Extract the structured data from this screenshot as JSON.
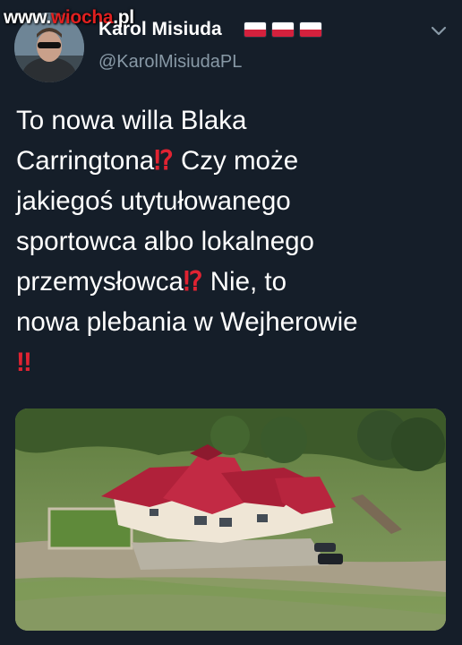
{
  "watermark": {
    "prefix": "www.",
    "accent": "wiocha",
    "suffix": ".pl"
  },
  "author": {
    "display_name": "Karol Misiuda",
    "handle": "@KarolMisiudaPL",
    "flag_count": 3,
    "flag_colors": [
      "#ffffff",
      "#d4213d"
    ]
  },
  "tweet": {
    "line1": "To nowa willa Blaka",
    "line2a": "Carringtona",
    "emoji1": "⁉",
    "line2b": " Czy może",
    "line3": "jakiegoś utytułowanego",
    "line4": "sportowca albo lokalnego",
    "line5a": "przemysłowca",
    "emoji2": "⁉",
    "line5b": " Nie, to",
    "line6": "nowa plebania w Wejherowie",
    "emoji3": "‼"
  },
  "icons": {
    "menu": "chevron-down-icon"
  },
  "colors": {
    "background": "#151e29",
    "secondary_text": "#8899a6",
    "emoji_red": "#e02332"
  }
}
